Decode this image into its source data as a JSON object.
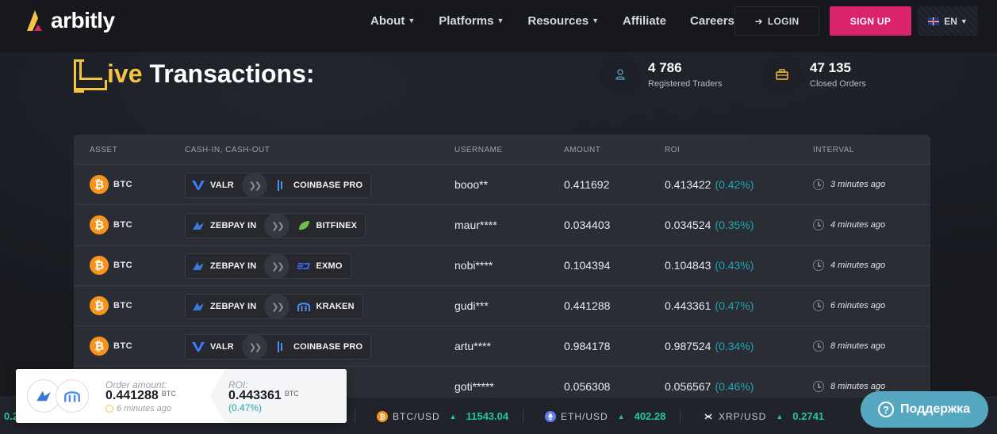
{
  "header": {
    "logo_text": "arbitly",
    "nav": [
      {
        "label": "About",
        "has_dropdown": true
      },
      {
        "label": "Platforms",
        "has_dropdown": true
      },
      {
        "label": "Resources",
        "has_dropdown": true
      },
      {
        "label": "Affiliate",
        "has_dropdown": false
      },
      {
        "label": "Careers",
        "has_dropdown": false
      }
    ],
    "login_label": "LOGIN",
    "signup_label": "SIGN UP",
    "lang_label": "EN",
    "colors": {
      "accent": "#d9236a",
      "brand_yellow": "#f5c242"
    }
  },
  "hero": {
    "title_highlight": "ive",
    "title_rest": "Transactions:",
    "stats": [
      {
        "value": "4 786",
        "label": "Registered Traders",
        "icon": "user-icon"
      },
      {
        "value": "47 135",
        "label": "Closed Orders",
        "icon": "briefcase-icon"
      }
    ]
  },
  "table": {
    "columns": [
      "ASSET",
      "CASH-IN, CASH-OUT",
      "USERNAME",
      "AMOUNT",
      "ROI",
      "INTERVAL"
    ],
    "rows": [
      {
        "asset": "BTC",
        "from": "VALR",
        "to": "COINBASE PRO",
        "user": "booo**",
        "amount": "0.411692",
        "roi": "0.413422",
        "roi_pct": "(0.42%)",
        "interval": "3 minutes ago"
      },
      {
        "asset": "BTC",
        "from": "ZEBPAY IN",
        "to": "BITFINEX",
        "user": "maur****",
        "amount": "0.034403",
        "roi": "0.034524",
        "roi_pct": "(0.35%)",
        "interval": "4 minutes ago"
      },
      {
        "asset": "BTC",
        "from": "ZEBPAY IN",
        "to": "EXMO",
        "user": "nobi****",
        "amount": "0.104394",
        "roi": "0.104843",
        "roi_pct": "(0.43%)",
        "interval": "4 minutes ago"
      },
      {
        "asset": "BTC",
        "from": "ZEBPAY IN",
        "to": "KRAKEN",
        "user": "gudi***",
        "amount": "0.441288",
        "roi": "0.443361",
        "roi_pct": "(0.47%)",
        "interval": "6 minutes ago"
      },
      {
        "asset": "BTC",
        "from": "VALR",
        "to": "COINBASE PRO",
        "user": "artu****",
        "amount": "0.984178",
        "roi": "0.987524",
        "roi_pct": "(0.34%)",
        "interval": "8 minutes ago"
      },
      {
        "asset": "BTC",
        "from": "",
        "to": "",
        "user": "goti*****",
        "amount": "0.056308",
        "roi": "0.056567",
        "roi_pct": "(0.46%)",
        "interval": "8 minutes ago"
      }
    ]
  },
  "popup": {
    "order_label": "Order amount:",
    "order_value": "0.441288",
    "order_unit": "BTC",
    "time": "6 minutes ago",
    "roi_label": "ROI:",
    "roi_value": "0.443361",
    "roi_unit": "BTC",
    "roi_pct": "(0.47%)"
  },
  "ticker": {
    "left_partial": "0.2",
    "items": [
      {
        "symbol": "BTC/USD",
        "price": "11543.04",
        "color": "#f7931a"
      },
      {
        "symbol": "ETH/USD",
        "price": "402.28",
        "color": "#627eea"
      },
      {
        "symbol": "XRP/USD",
        "price": "0.2741",
        "color": "#23292f"
      }
    ]
  },
  "support": {
    "label": "Поддержка"
  }
}
